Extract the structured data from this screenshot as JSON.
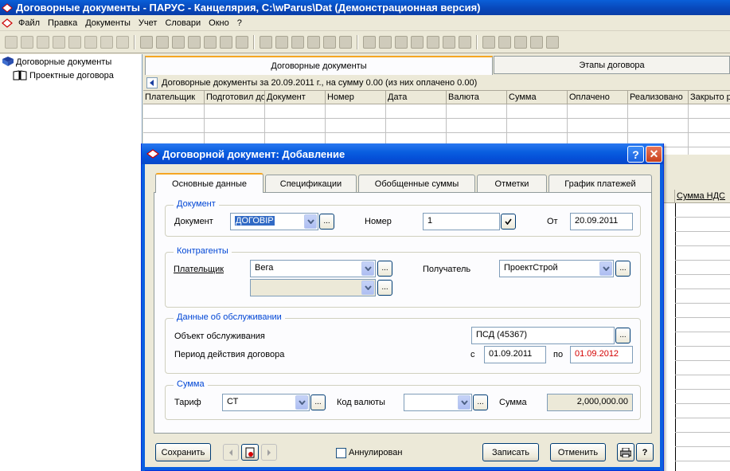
{
  "window": {
    "title": "Договорные документы - ПАРУС - Канцелярия, C:\\wParus\\Dat (Демонстрационная версия)"
  },
  "menu": [
    "Файл",
    "Правка",
    "Документы",
    "Учет",
    "Словари",
    "Окно",
    "?"
  ],
  "tree": {
    "root": "Договорные документы",
    "child": "Проектные договора"
  },
  "main": {
    "tabs": [
      "Договорные документы",
      "Этапы договора"
    ],
    "info": "Договорные документы за 20.09.2011 г., на сумму 0.00  (из них оплачено 0.00)",
    "columns": [
      "Плательщик",
      "Подготовил до",
      "Документ",
      "Номер",
      "Дата",
      "Валюта",
      "Сумма",
      "Оплачено",
      "Реализовано",
      "Закрыто р"
    ],
    "nds_column": "Сумма НДС"
  },
  "dialog": {
    "title": "Договорной документ: Добавление",
    "help_btn": "?",
    "close_btn": "✕",
    "tabs": [
      "Основные данные",
      "Спецификации",
      "Обобщенные суммы",
      "Отметки",
      "График платежей"
    ],
    "document": {
      "group": "Документ",
      "doc_label": "Документ",
      "doc_value": "ДОГОВІР",
      "number_label": "Номер",
      "number_value": "1",
      "from_label": "От",
      "from_value": "20.09.2011"
    },
    "contractors": {
      "group": "Контрагенты",
      "payer_label": "Плательщик",
      "payer_value": "Вега",
      "payer2_value": "",
      "receiver_label": "Получатель",
      "receiver_value": "ПроектСтрой"
    },
    "service": {
      "group": "Данные об обслуживании",
      "object_label": "Объект обслуживания",
      "object_value": "ПСД (45367)",
      "period_label": "Период действия договора",
      "from_prefix": "с",
      "from_value": "01.09.2011",
      "to_prefix": "по",
      "to_value": "01.09.2012"
    },
    "sum": {
      "group": "Сумма",
      "tariff_label": "Тариф",
      "tariff_value": "СТ",
      "currency_label": "Код валюты",
      "currency_value": "",
      "sum_label": "Сумма",
      "sum_value": "2,000,000.00"
    },
    "footer": {
      "save": "Сохранить",
      "annul": "Аннулирован",
      "write": "Записать",
      "cancel": "Отменить",
      "help": "?"
    },
    "dots": "...",
    "colors": {
      "accent": "#0a5fe0",
      "red_date": "#d40000",
      "group_title": "#0046d5"
    }
  }
}
